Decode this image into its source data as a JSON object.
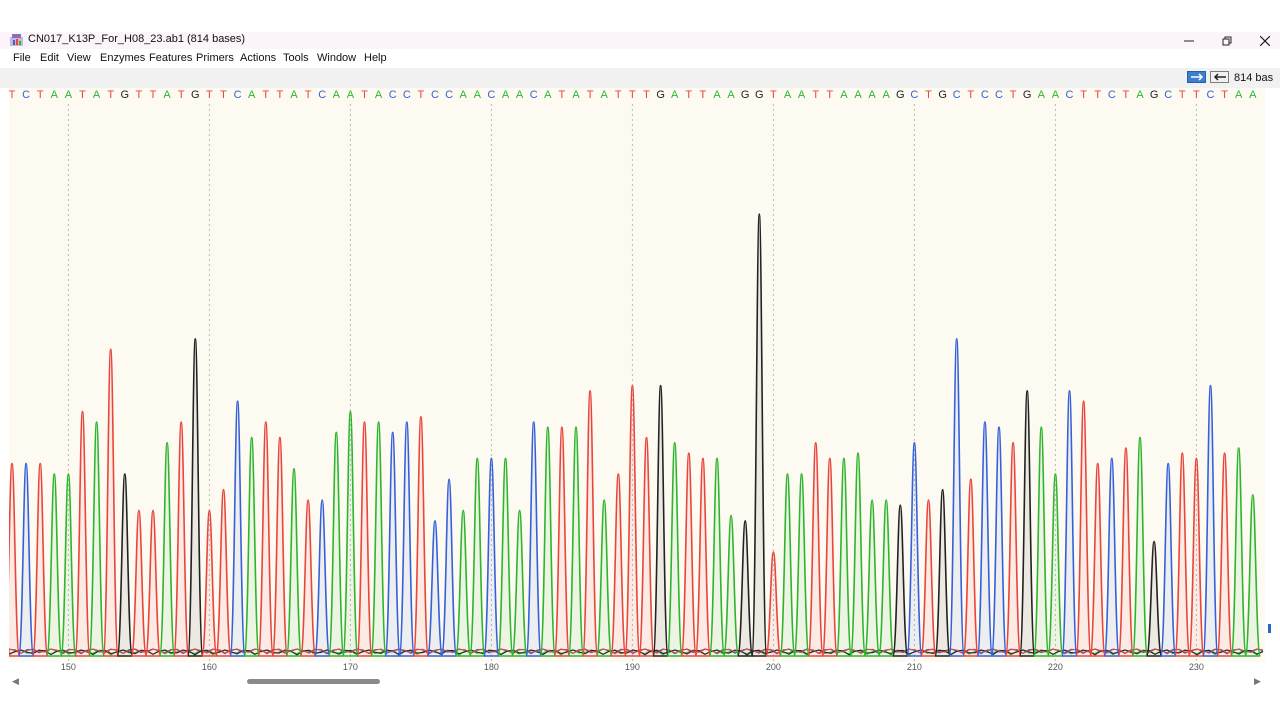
{
  "window": {
    "title": "CN017_K13P_For_H08_23.ab1  (814 bases)",
    "minimize_icon": "minimize-icon",
    "maximize_icon": "restore-icon",
    "close_icon": "close-icon"
  },
  "menu": [
    "File",
    "Edit",
    "View",
    "Enzymes",
    "Features",
    "Primers",
    "Actions",
    "Tools",
    "Window",
    "Help"
  ],
  "toolbar": {
    "forward_icon": "arrow-right-icon",
    "reverse_icon": "arrow-left-icon",
    "base_count": "814 bas"
  },
  "colors": {
    "A": "#2db52d",
    "C": "#3660d9",
    "G": "#222222",
    "T": "#e8453c"
  },
  "sequence": "TCTAATATGTTATGTTCATTATCAATACCTCCAACAACATATATTTGATTAAGGTAATTAAAAGCTGCTCCTGAACTTCTAGCTTCTAA",
  "first_base_number": 146,
  "peak_heights": [
    0.37,
    0.37,
    0.37,
    0.35,
    0.35,
    0.47,
    0.45,
    0.59,
    0.35,
    0.28,
    0.28,
    0.41,
    0.45,
    0.61,
    0.28,
    0.32,
    0.49,
    0.42,
    0.45,
    0.42,
    0.36,
    0.3,
    0.3,
    0.43,
    0.47,
    0.45,
    0.45,
    0.43,
    0.45,
    0.46,
    0.26,
    0.34,
    0.28,
    0.38,
    0.38,
    0.38,
    0.28,
    0.45,
    0.44,
    0.44,
    0.44,
    0.51,
    0.3,
    0.35,
    0.52,
    0.42,
    0.52,
    0.41,
    0.39,
    0.38,
    0.38,
    0.27,
    0.26,
    0.85,
    0.2,
    0.35,
    0.35,
    0.41,
    0.38,
    0.38,
    0.39,
    0.3,
    0.3,
    0.29,
    0.41,
    0.3,
    0.32,
    0.61,
    0.34,
    0.45,
    0.44,
    0.41,
    0.51,
    0.44,
    0.35,
    0.51,
    0.49,
    0.37,
    0.38,
    0.4,
    0.42,
    0.22,
    0.37,
    0.39,
    0.38,
    0.52,
    0.39,
    0.4,
    0.31,
    0.31
  ],
  "axis": {
    "ticks": [
      150,
      160,
      170,
      180,
      190,
      200,
      210,
      220,
      230
    ]
  },
  "scrollbar": {
    "left_icon": "scroll-left-icon",
    "right_icon": "scroll-right-icon",
    "position": 0.19
  }
}
